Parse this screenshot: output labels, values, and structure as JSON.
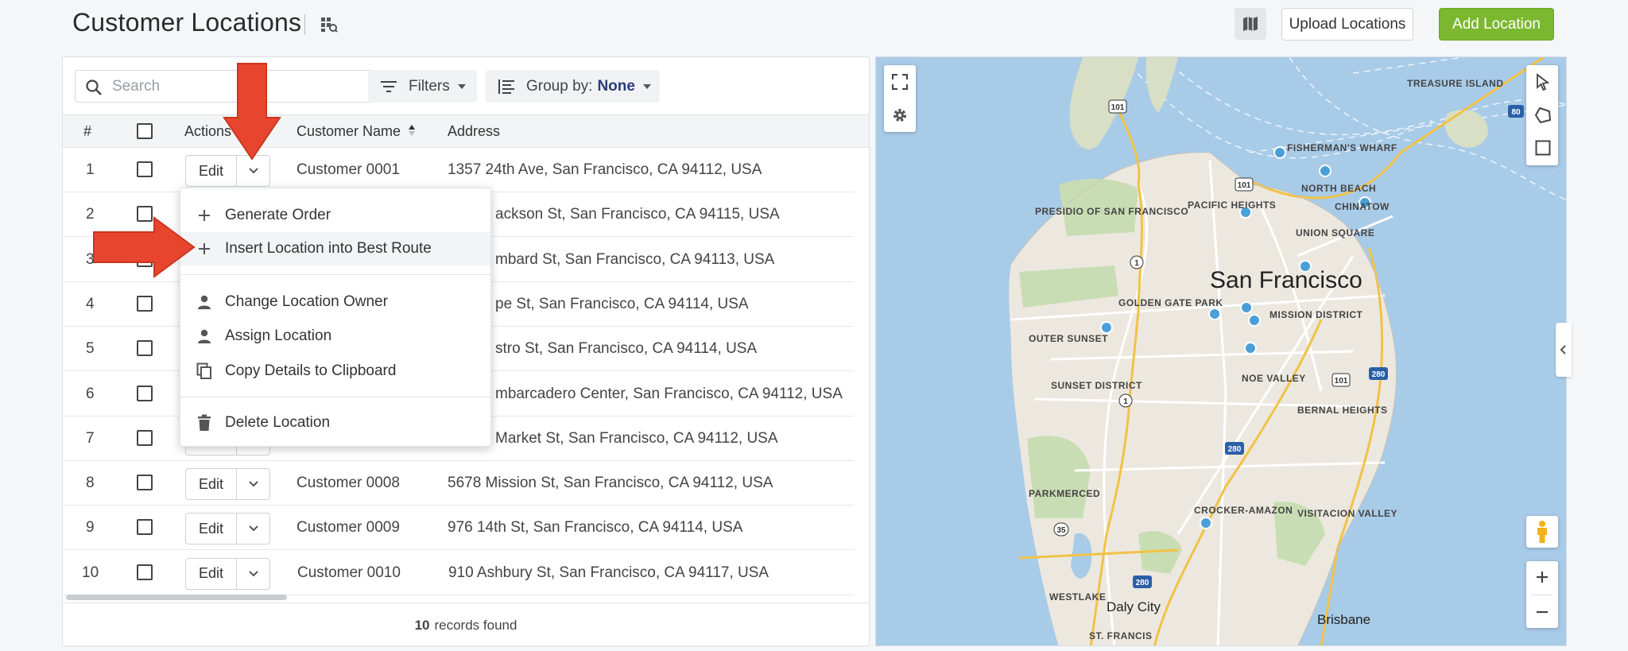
{
  "header": {
    "title": "Customer Locations",
    "upload_label": "Upload Locations",
    "add_label": "Add Location"
  },
  "toolbar": {
    "search_placeholder": "Search",
    "filters_label": "Filters",
    "groupby_label": "Group by:",
    "groupby_value": "None"
  },
  "table": {
    "headers": {
      "num": "#",
      "actions": "Actions",
      "name": "Customer Name",
      "address": "Address"
    },
    "edit_label": "Edit",
    "rows": [
      {
        "num": "1",
        "name": "Customer 0001",
        "address": "1357 24th Ave, San Francisco, CA 94112, USA"
      },
      {
        "num": "2",
        "name": "",
        "address": "ackson St, San Francisco, CA 94115, USA"
      },
      {
        "num": "3",
        "name": "",
        "address": "mbard St, San Francisco, CA 94113, USA"
      },
      {
        "num": "4",
        "name": "",
        "address": "pe St, San Francisco, CA 94114, USA"
      },
      {
        "num": "5",
        "name": "",
        "address": "stro St, San Francisco, CA 94114, USA"
      },
      {
        "num": "6",
        "name": "",
        "address": "mbarcadero Center, San Francisco, CA 94112, USA"
      },
      {
        "num": "7",
        "name": "",
        "address": "Market St, San Francisco, CA 94112, USA"
      },
      {
        "num": "8",
        "name": "Customer 0008",
        "address": "5678 Mission St, San Francisco, CA 94112, USA"
      },
      {
        "num": "9",
        "name": "Customer 0009",
        "address": "976 14th St, San Francisco, CA 94114, USA"
      },
      {
        "num": "10",
        "name": "Customer 0010",
        "address": "910 Ashbury St, San Francisco, CA 94117, USA"
      }
    ],
    "footer_count": "10",
    "footer_text": "records found"
  },
  "menu": {
    "items": [
      {
        "label": "Generate Order",
        "icon": "plus-icon"
      },
      {
        "label": "Insert Location into Best Route",
        "icon": "plus-icon"
      },
      {
        "label": "Change Location Owner",
        "icon": "person-icon"
      },
      {
        "label": "Assign Location",
        "icon": "person-icon"
      },
      {
        "label": "Copy Details to Clipboard",
        "icon": "copy-icon"
      },
      {
        "label": "Delete Location",
        "icon": "trash-icon"
      }
    ]
  },
  "map": {
    "city_label": "San Francisco",
    "labels": {
      "treasure_island": "TREASURE ISLAND",
      "fishermans_wharf": "FISHERMAN'S WHARF",
      "north_beach": "NORTH BEACH",
      "chinatown": "CHINATOW",
      "pacific_heights": "PACIFIC HEIGHTS",
      "presidio": "PRESIDIO OF SAN FRANCISCO",
      "union_square": "UNION SQUARE",
      "golden_gate_park": "GOLDEN GATE PARK",
      "mission_district": "MISSION DISTRICT",
      "outer_sunset": "OUTER SUNSET",
      "noe_valley": "NOE VALLEY",
      "sunset_district": "SUNSET DISTRICT",
      "bernal_heights": "BERNAL HEIGHTS",
      "parkmerced": "PARKMERCED",
      "crocker_amazon": "CROCKER-AMAZON",
      "visitacion_valley": "VISITACION VALLEY",
      "westlake": "WESTLAKE",
      "daly_city": "Daly City",
      "brisbane": "Brisbane",
      "st_francis": "ST. FRANCIS"
    },
    "shields": {
      "s101a": "101",
      "s101b": "101",
      "s101c": "101",
      "s1a": "1",
      "s1b": "1",
      "s280a": "280",
      "s280b": "280",
      "s280c": "280",
      "s35": "35",
      "s80": "80"
    }
  },
  "colors": {
    "accent_green": "#7cb82f",
    "arrow_red": "#e8452f",
    "water": "#a8cbe8",
    "land": "#ece8df",
    "park": "#c9ddb4",
    "marker": "#4a9fd8"
  }
}
